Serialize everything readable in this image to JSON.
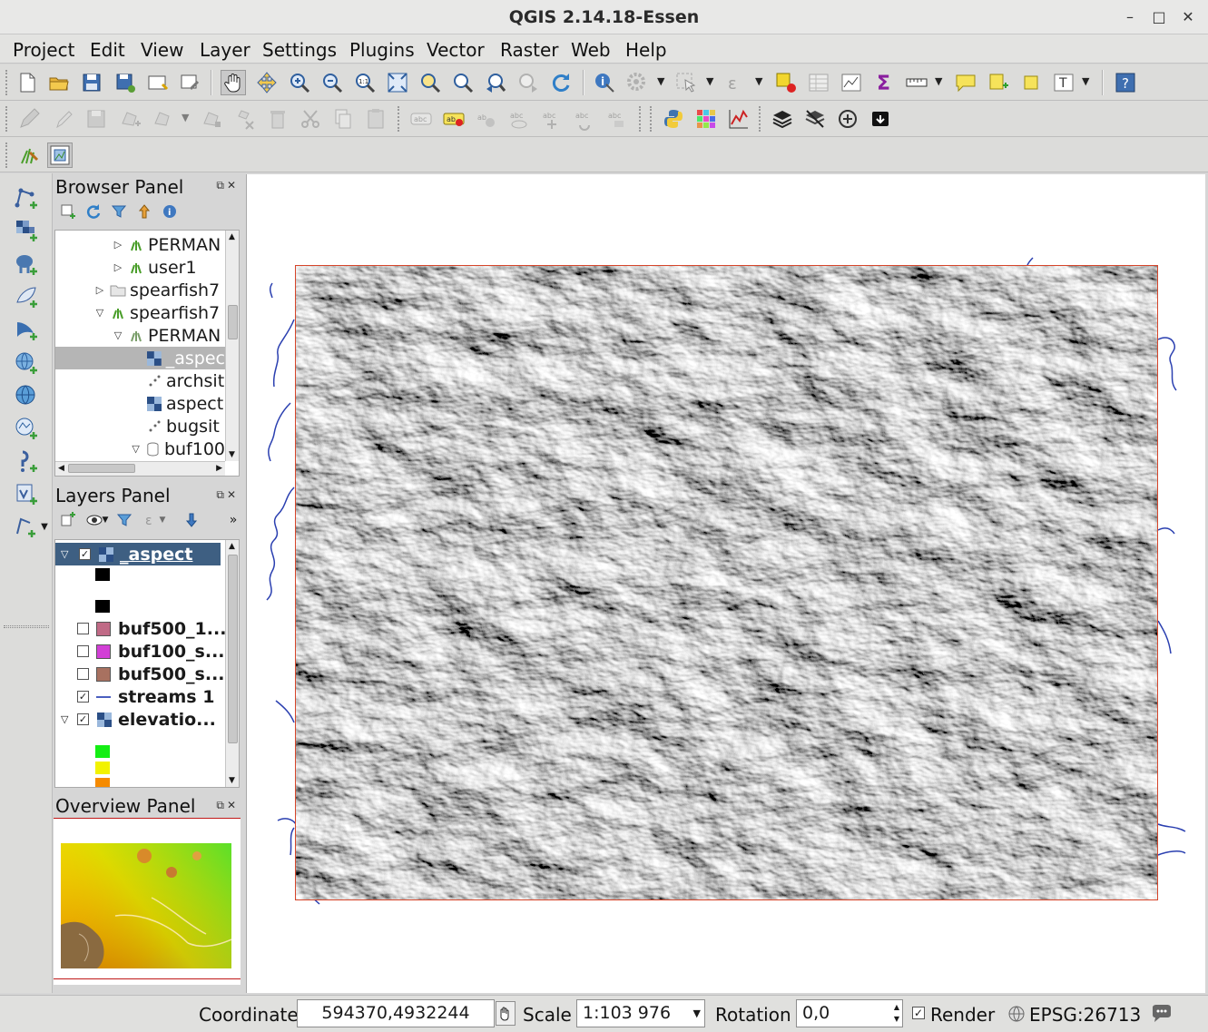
{
  "window": {
    "title": "QGIS 2.14.18-Essen",
    "controls": [
      "–",
      "□",
      "✕"
    ]
  },
  "menubar": [
    "Project",
    "Edit",
    "View",
    "Layer",
    "Settings",
    "Plugins",
    "Vector",
    "Raster",
    "Web",
    "Help"
  ],
  "browser_panel": {
    "title": "Browser Panel",
    "items": [
      {
        "label": "PERMAN",
        "icon": "grass-mapset-icon"
      },
      {
        "label": "user1",
        "icon": "grass-mapset-icon"
      },
      {
        "label": "spearfish7",
        "icon": "folder-icon"
      },
      {
        "label": "spearfish7",
        "icon": "grass-location-icon"
      },
      {
        "label": "PERMAN",
        "icon": "grass-mapset-icon"
      },
      {
        "label": "_aspec",
        "icon": "raster-layer-icon"
      },
      {
        "label": "archsit",
        "icon": "point-layer-icon"
      },
      {
        "label": "aspect",
        "icon": "raster-layer-icon"
      },
      {
        "label": "bugsit",
        "icon": "point-layer-icon"
      },
      {
        "label": "buf100",
        "icon": "database-icon"
      }
    ]
  },
  "layers_panel": {
    "title": "Layers Panel",
    "layers": [
      {
        "name": "_aspect",
        "checked": true,
        "selected": true
      },
      {
        "name": "buf500_1...",
        "checked": false,
        "color": "#c06a86"
      },
      {
        "name": "buf100_s...",
        "checked": false,
        "color": "#d23fd6"
      },
      {
        "name": "buf500_s...",
        "checked": false,
        "color": "#a87160"
      },
      {
        "name": "streams 1",
        "checked": true,
        "color": "#4a5fbf"
      },
      {
        "name": "elevatio...",
        "checked": true
      }
    ],
    "elevation_legend_colors": [
      "#14ee14",
      "#f2f200",
      "#f58a00"
    ],
    "aspect_legend_colors": [
      "#000000",
      "#000000"
    ]
  },
  "overview_panel": {
    "title": "Overview Panel"
  },
  "statusbar": {
    "coordinate_label": "Coordinate",
    "coordinate_value": "594370,4932244",
    "scale_label": "Scale",
    "scale_value": "1:103 976",
    "rotation_label": "Rotation",
    "rotation_value": "0,0",
    "render_label": "Render",
    "render_checked": true,
    "crs": "EPSG:26713"
  }
}
